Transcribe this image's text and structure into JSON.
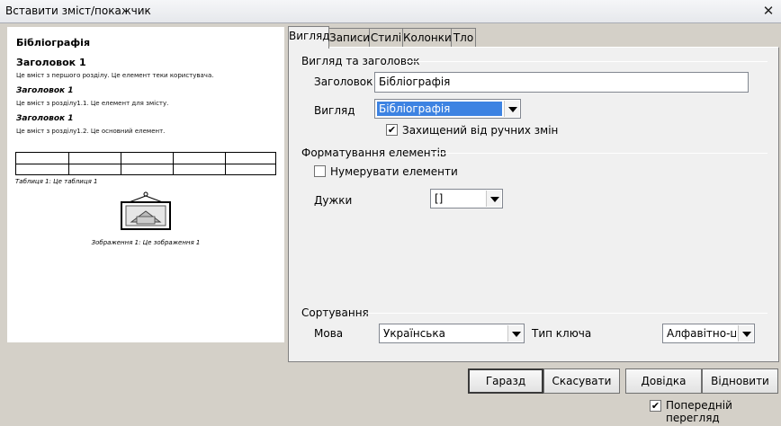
{
  "window": {
    "title": "Вставити зміст/покажчик",
    "close_glyph": "✕"
  },
  "preview": {
    "title": "Бібліографія",
    "heading1": "Заголовок 1",
    "text1": "Це вміст з першого розділу. Це елемент теки користувача.",
    "heading1_1": "Заголовок 1",
    "text1_1": "Це вміст з розділу1.1. Це елемент для змісту.",
    "heading1_2": "Заголовок 1",
    "text1_2": "Це вміст з розділу1.2. Це основний елемент.",
    "table_caption": "Таблиця 1: Це таблиця 1",
    "image_caption": "Зображення 1: Це зображення 1"
  },
  "tabs": [
    {
      "label": "Вигляд",
      "active": true
    },
    {
      "label": "Записи",
      "active": false
    },
    {
      "label": "Стилі",
      "active": false
    },
    {
      "label": "Колонки",
      "active": false
    },
    {
      "label": "Тло",
      "active": false
    }
  ],
  "type_section": {
    "label": "Вигляд та заголовок",
    "title_label": "Заголовок",
    "title_value": "Бібліографія",
    "type_label": "Вигляд",
    "type_value": "Бібліографія",
    "protected_label": "Захищений від ручних змін",
    "protected_checked": true
  },
  "format_section": {
    "label": "Форматування елементів",
    "number_entries_label": "Нумерувати елементи",
    "number_entries_checked": false,
    "brackets_label": "Дужки",
    "brackets_value": "[]"
  },
  "sort_section": {
    "label": "Сортування",
    "language_label": "Мова",
    "language_value": "Українська",
    "key_type_label": "Тип ключа",
    "key_type_value": "Алфавітно-циф"
  },
  "buttons": {
    "ok": "Гаразд",
    "cancel": "Скасувати",
    "help": "Довідка",
    "reset": "Відновити"
  },
  "preview_toggle": {
    "label": "Попередній перегляд",
    "checked": true
  },
  "check_glyph": "✔"
}
